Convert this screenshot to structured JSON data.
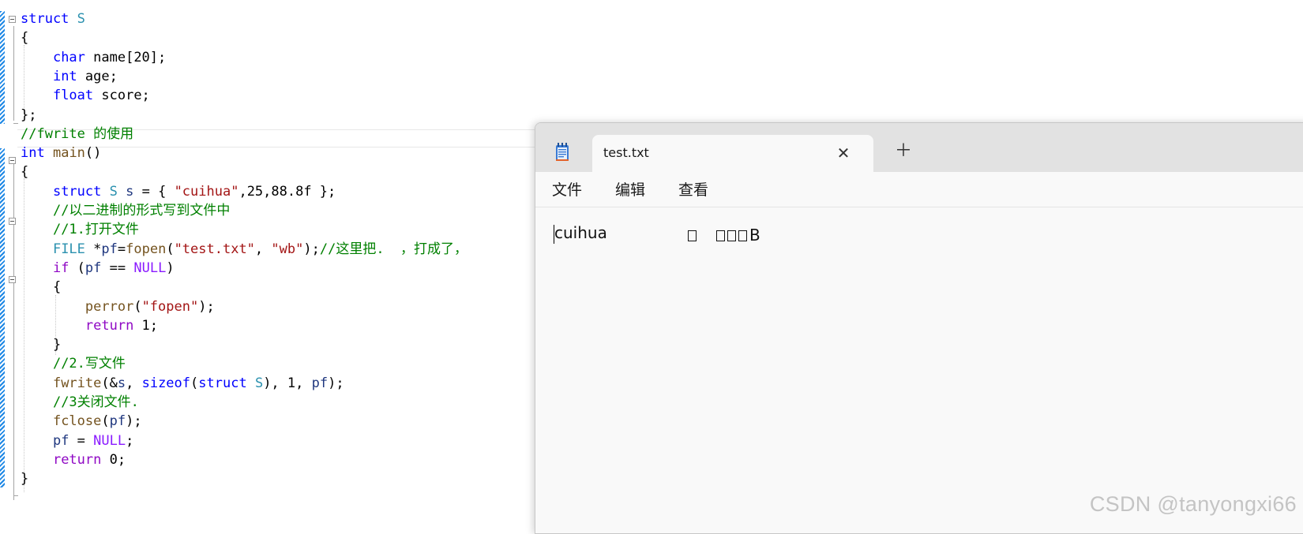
{
  "editor": {
    "lines": [
      [
        {
          "t": "struct",
          "c": "kw"
        },
        {
          "t": " ",
          "c": "pl"
        },
        {
          "t": "S",
          "c": "ty"
        }
      ],
      [
        {
          "t": "{",
          "c": "pl"
        }
      ],
      [
        {
          "t": "    ",
          "c": "pl"
        },
        {
          "t": "char",
          "c": "kw"
        },
        {
          "t": " name[20];",
          "c": "pl"
        }
      ],
      [
        {
          "t": "    ",
          "c": "pl"
        },
        {
          "t": "int",
          "c": "kw"
        },
        {
          "t": " age;",
          "c": "pl"
        }
      ],
      [
        {
          "t": "    ",
          "c": "pl"
        },
        {
          "t": "float",
          "c": "kw"
        },
        {
          "t": " score;",
          "c": "pl"
        }
      ],
      [
        {
          "t": "};",
          "c": "pl"
        }
      ],
      [
        {
          "t": "//fwrite 的使用",
          "c": "cm"
        }
      ],
      [
        {
          "t": "int",
          "c": "kw"
        },
        {
          "t": " ",
          "c": "pl"
        },
        {
          "t": "main",
          "c": "fn"
        },
        {
          "t": "()",
          "c": "pl"
        }
      ],
      [
        {
          "t": "{",
          "c": "pl"
        }
      ],
      [
        {
          "t": "    ",
          "c": "pl"
        },
        {
          "t": "struct",
          "c": "kw"
        },
        {
          "t": " ",
          "c": "pl"
        },
        {
          "t": "S",
          "c": "ty"
        },
        {
          "t": " ",
          "c": "pl"
        },
        {
          "t": "s",
          "c": "var"
        },
        {
          "t": " = { ",
          "c": "pl"
        },
        {
          "t": "\"cuihua\"",
          "c": "str"
        },
        {
          "t": ",25,88.8f };",
          "c": "pl"
        }
      ],
      [
        {
          "t": "    ",
          "c": "pl"
        },
        {
          "t": "//以二进制的形式写到文件中",
          "c": "cm"
        }
      ],
      [
        {
          "t": "    ",
          "c": "pl"
        },
        {
          "t": "//1.打开文件",
          "c": "cm"
        }
      ],
      [
        {
          "t": "    ",
          "c": "pl"
        },
        {
          "t": "FILE",
          "c": "ty"
        },
        {
          "t": " *",
          "c": "pl"
        },
        {
          "t": "pf",
          "c": "var"
        },
        {
          "t": "=",
          "c": "pl"
        },
        {
          "t": "fopen",
          "c": "fn"
        },
        {
          "t": "(",
          "c": "pl"
        },
        {
          "t": "\"test.txt\"",
          "c": "str"
        },
        {
          "t": ", ",
          "c": "pl"
        },
        {
          "t": "\"wb\"",
          "c": "str"
        },
        {
          "t": ");",
          "c": "pl"
        },
        {
          "t": "//这里把.  ，打成了，",
          "c": "cm"
        }
      ],
      [
        {
          "t": "    ",
          "c": "pl"
        },
        {
          "t": "if",
          "c": "kw2"
        },
        {
          "t": " (",
          "c": "pl"
        },
        {
          "t": "pf",
          "c": "var"
        },
        {
          "t": " == ",
          "c": "pl"
        },
        {
          "t": "NULL",
          "c": "mac"
        },
        {
          "t": ")",
          "c": "pl"
        }
      ],
      [
        {
          "t": "    {",
          "c": "pl"
        }
      ],
      [
        {
          "t": "        ",
          "c": "pl"
        },
        {
          "t": "perror",
          "c": "fn"
        },
        {
          "t": "(",
          "c": "pl"
        },
        {
          "t": "\"fopen\"",
          "c": "str"
        },
        {
          "t": ");",
          "c": "pl"
        }
      ],
      [
        {
          "t": "        ",
          "c": "pl"
        },
        {
          "t": "return",
          "c": "kw2"
        },
        {
          "t": " 1;",
          "c": "pl"
        }
      ],
      [
        {
          "t": "    }",
          "c": "pl"
        }
      ],
      [
        {
          "t": "    ",
          "c": "pl"
        },
        {
          "t": "//2.写文件",
          "c": "cm"
        }
      ],
      [
        {
          "t": "    ",
          "c": "pl"
        },
        {
          "t": "fwrite",
          "c": "fn"
        },
        {
          "t": "(&",
          "c": "pl"
        },
        {
          "t": "s",
          "c": "var"
        },
        {
          "t": ", ",
          "c": "pl"
        },
        {
          "t": "sizeof",
          "c": "kw"
        },
        {
          "t": "(",
          "c": "pl"
        },
        {
          "t": "struct",
          "c": "kw"
        },
        {
          "t": " ",
          "c": "pl"
        },
        {
          "t": "S",
          "c": "ty"
        },
        {
          "t": "), 1, ",
          "c": "pl"
        },
        {
          "t": "pf",
          "c": "var"
        },
        {
          "t": ");",
          "c": "pl"
        }
      ],
      [
        {
          "t": "    ",
          "c": "pl"
        },
        {
          "t": "//3关闭文件.",
          "c": "cm"
        }
      ],
      [
        {
          "t": "    ",
          "c": "pl"
        },
        {
          "t": "fclose",
          "c": "fn"
        },
        {
          "t": "(",
          "c": "pl"
        },
        {
          "t": "pf",
          "c": "var"
        },
        {
          "t": ");",
          "c": "pl"
        }
      ],
      [
        {
          "t": "    ",
          "c": "pl"
        },
        {
          "t": "pf",
          "c": "var"
        },
        {
          "t": " = ",
          "c": "pl"
        },
        {
          "t": "NULL",
          "c": "mac"
        },
        {
          "t": ";",
          "c": "pl"
        }
      ],
      [
        {
          "t": "    ",
          "c": "pl"
        },
        {
          "t": "return",
          "c": "kw2"
        },
        {
          "t": " 0;",
          "c": "pl"
        }
      ],
      [
        {
          "t": "}",
          "c": "pl"
        }
      ]
    ]
  },
  "notepad": {
    "tab_title": "test.txt",
    "close_icon": "close-icon",
    "new_tab_icon": "plus-icon",
    "app_icon": "notepad-icon",
    "menu": [
      "文件",
      "编辑",
      "查看"
    ],
    "content": "cuihua",
    "content_tail": "B"
  },
  "watermark": "CSDN @tanyongxi66"
}
